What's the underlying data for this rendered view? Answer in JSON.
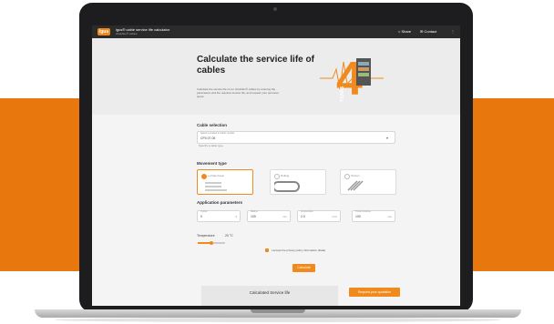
{
  "app": {
    "logo_text": "igus",
    "title": "igus® cable service life calculator",
    "subtitle": "chainflex® cables",
    "share_label": "Share",
    "contact_label": "Contact"
  },
  "hero": {
    "title": "Calculate the service life of cables",
    "description": "Calculate the service life of our chainflex® cables by entering the parameters and the required service life, and request your personal quote."
  },
  "cable_selection": {
    "heading": "Cable selection",
    "field_label": "Select a product or article number",
    "value": "CF5.07.05",
    "hint": "Specify a cable type"
  },
  "movement_type": {
    "heading": "Movement type",
    "options": [
      {
        "label": "e-chain linear",
        "selected": true
      },
      {
        "label": "Rolling",
        "selected": false
      },
      {
        "label": "Torsion",
        "selected": false
      }
    ]
  },
  "parameters": {
    "heading": "Application parameters",
    "fields": [
      {
        "label": "Cycles",
        "value": "0",
        "unit": ""
      },
      {
        "label": "Radius",
        "value": "100",
        "unit": "mm"
      },
      {
        "label": "Acceleration",
        "value": "2.0",
        "unit": "m/s²"
      },
      {
        "label": "Travel distance",
        "value": "100",
        "unit": "m/s"
      }
    ]
  },
  "temperature": {
    "label": "Temperature",
    "value": "20 °C",
    "level": 0.5
  },
  "consent": {
    "text": "I accept the privacy policy information (Data)"
  },
  "calculate_label": "Calculate",
  "result": {
    "title": "Calculated Service life",
    "quote_label": "Request your quotation"
  },
  "colors": {
    "accent": "#f08a1c",
    "band": "#e8780e"
  },
  "graphic": {
    "number": "4",
    "word": "YEARS"
  }
}
